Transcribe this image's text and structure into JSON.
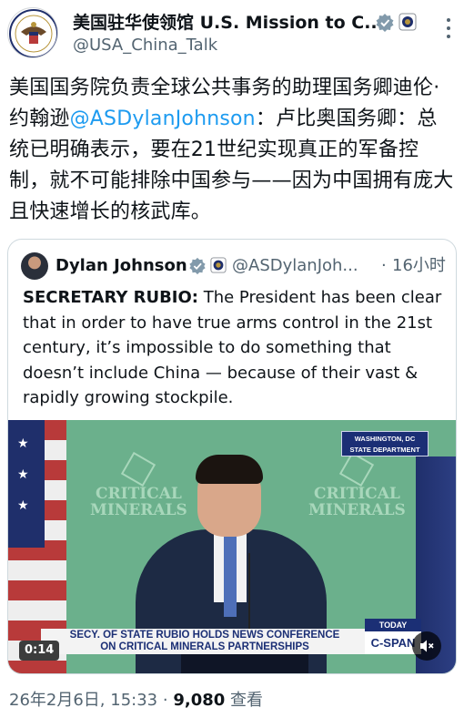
{
  "author": {
    "display_name": "美国驻华使领馆 U.S. Mission to C...",
    "handle": "@USA_China_Talk",
    "avatar_icon": "us-seal-icon",
    "badges": [
      "gray-verified-badge-icon",
      "us-seal-affiliate-icon"
    ]
  },
  "post": {
    "text_before": "美国国务院负责全球公共事务的助理国务卿迪伦·约翰逊",
    "mention": "@ASDylanJohnson",
    "text_after": "：卢比奥国务卿：总统已明确表示，要在21世纪实现真正的军备控制，就不可能排除中国参与——因为中国拥有庞大且快速增长的核武库。"
  },
  "quoted_post": {
    "display_name": "Dylan Johnson",
    "handle": "@ASDylanJoh...",
    "separator": "·",
    "time": "16小时",
    "bold_prefix": "SECRETARY RUBIO:",
    "text": " The President has been clear that in order to have true arms control in the 21st century, it’s impossible to do something that doesn’t include China — because of their vast & rapidly growing stockpile.",
    "video": {
      "duration": "0:14",
      "location_line1": "WASHINGTON, DC",
      "location_line2": "STATE DEPARTMENT",
      "watermark_line1": "CRITICAL",
      "watermark_line2": "MINERALS",
      "chyron_line1": "SECY. OF STATE RUBIO HOLDS NEWS CONFERENCE",
      "chyron_line2": "ON CRITICAL MINERALS PARTNERSHIPS",
      "today": "TODAY",
      "network": "C-SPAN",
      "mute_icon": "speaker-muted-icon"
    }
  },
  "meta": {
    "date": "26年2月6日, 15:33",
    "separator": "·",
    "views": "9,080",
    "views_label": "查看"
  },
  "colors": {
    "link": "#1d9bf0",
    "secondary_text": "#536471",
    "primary_text": "#0f1419",
    "border": "#cfd9de"
  }
}
